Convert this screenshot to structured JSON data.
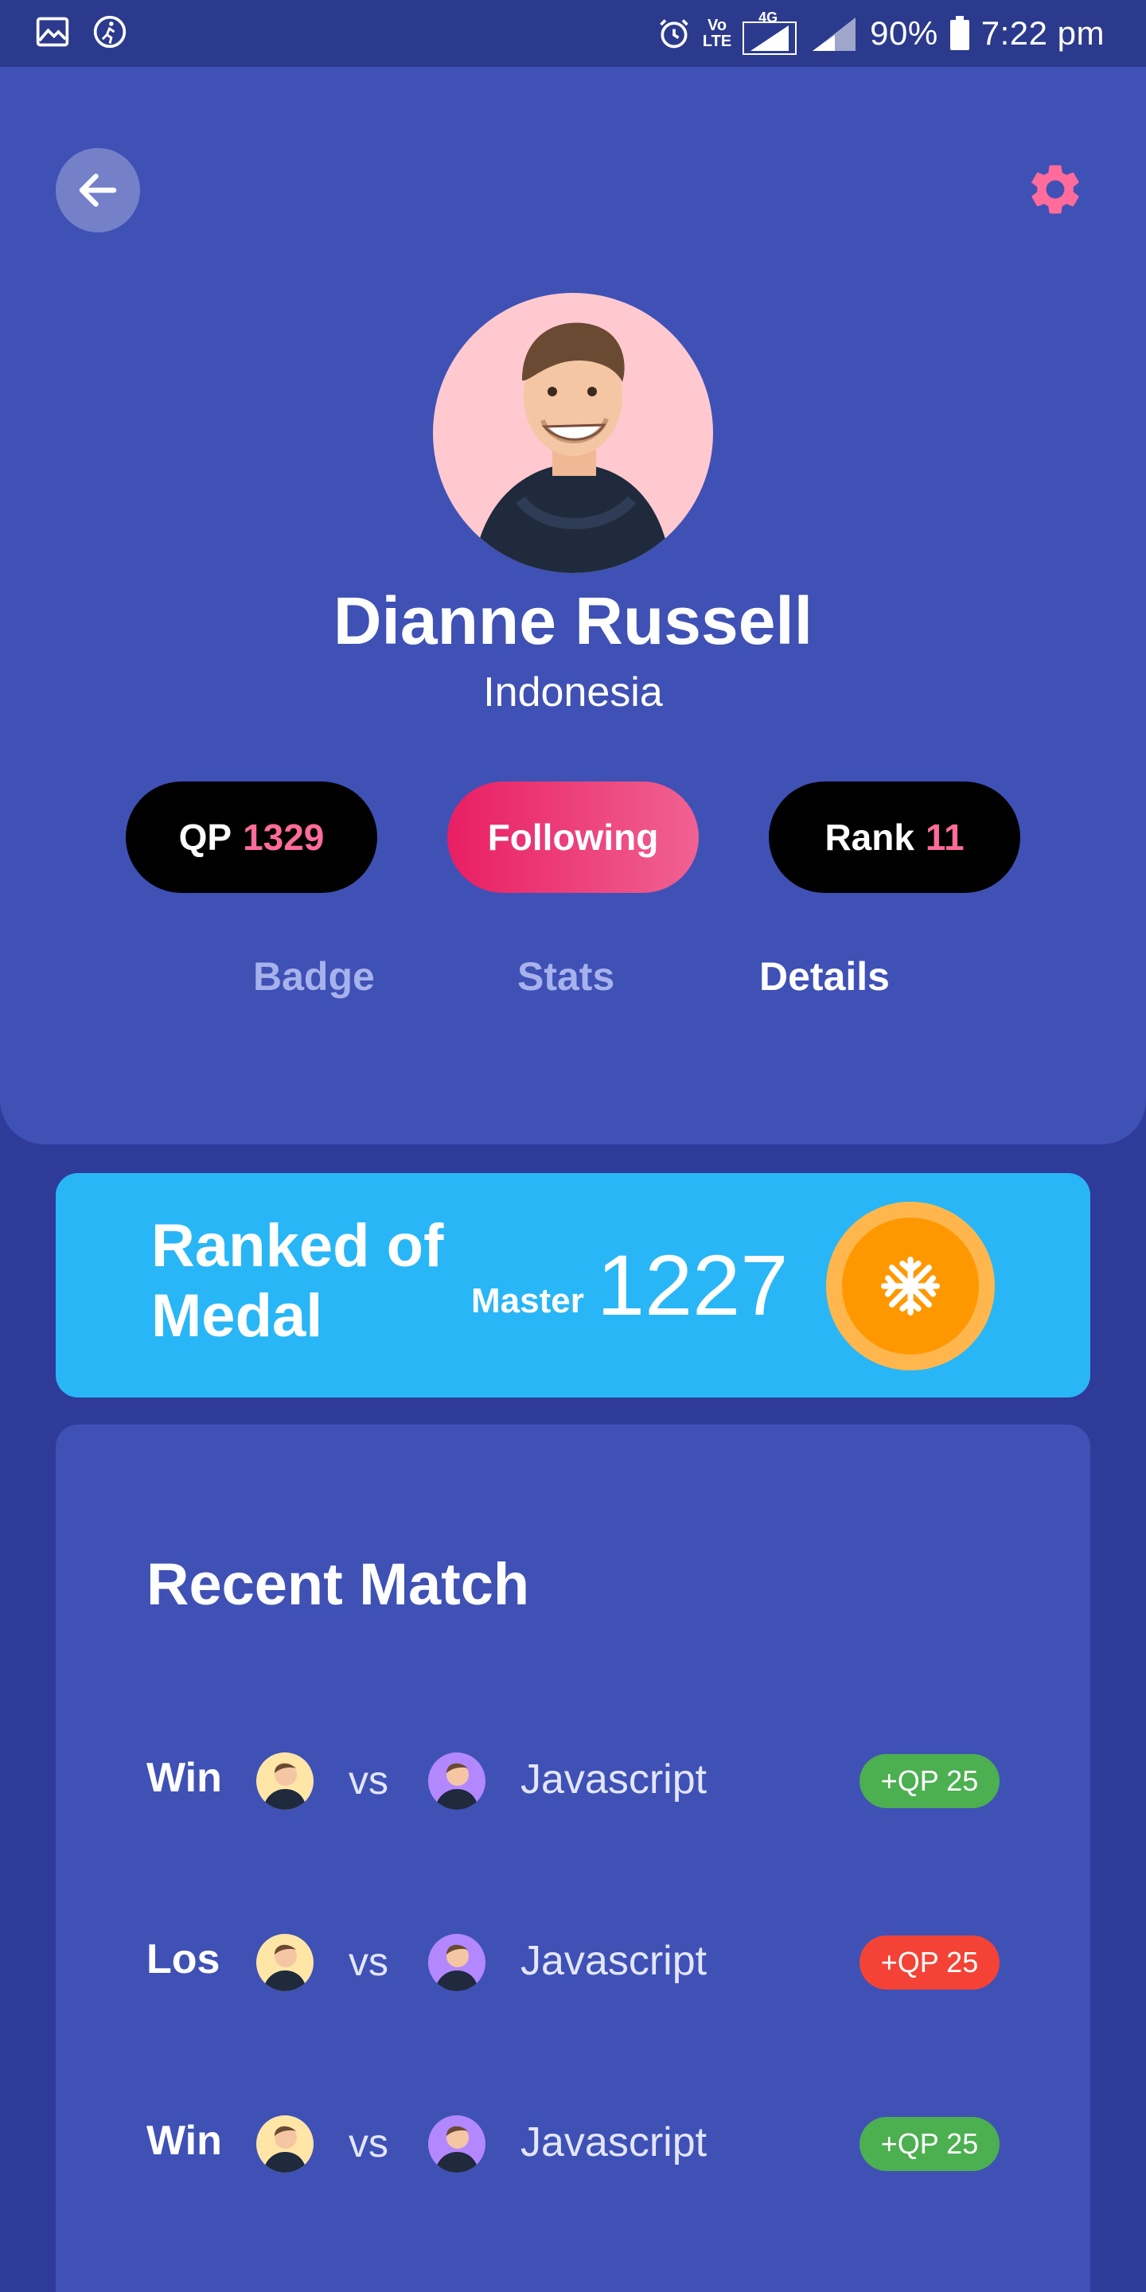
{
  "status_bar": {
    "battery": "90%",
    "time": "7:22 pm",
    "network": "4G",
    "volte_line1": "Vo",
    "volte_line2": "LTE",
    "icons": [
      "image-icon",
      "activity-icon",
      "alarm-icon",
      "signal-icon",
      "battery-icon"
    ]
  },
  "header": {
    "back_icon": "arrow-left-icon",
    "settings_icon": "gear-icon",
    "name": "Dianne Russell",
    "country": "Indonesia",
    "qp_label": "QP",
    "qp_value": "1329",
    "follow_label": "Following",
    "rank_label": "Rank",
    "rank_value": "11",
    "tabs": [
      {
        "label": "Badge",
        "active": false
      },
      {
        "label": "Stats",
        "active": false
      },
      {
        "label": "Details",
        "active": true
      }
    ]
  },
  "medal": {
    "title": "Ranked of Medal",
    "level": "Master",
    "score": "1227",
    "icon": "snowflake-icon"
  },
  "recent_match": {
    "title": "Recent Match",
    "vs_label": "vs",
    "matches": [
      {
        "result": "Win",
        "topic": "Javascript",
        "points": "+QP 25",
        "color": "#4caf50"
      },
      {
        "result": "Los",
        "topic": "Javascript",
        "points": "+QP 25",
        "color": "#f44336"
      },
      {
        "result": "Win",
        "topic": "Javascript",
        "points": "+QP 25",
        "color": "#4caf50"
      }
    ]
  },
  "colors": {
    "background": "#2f3b99",
    "panel": "#3f51b5",
    "accent_pink": "#ff6b9a",
    "medal_card": "#29b6f6",
    "coin": "#ff9800",
    "win": "#4caf50",
    "loss": "#f44336"
  }
}
